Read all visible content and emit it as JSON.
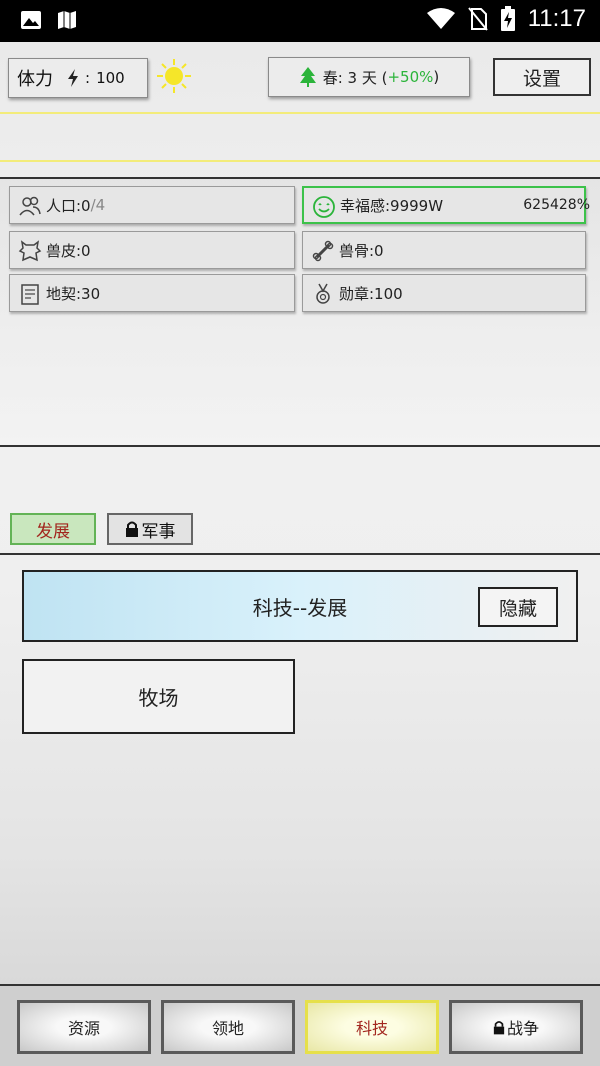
{
  "status_bar": {
    "time": "11:17"
  },
  "top": {
    "stamina_label": "体力",
    "stamina_value": "100",
    "season_label": "春: 3 天 (",
    "season_bonus": "+50%",
    "season_close": ")",
    "settings_label": "设置"
  },
  "resources": {
    "population_label": "人口:0",
    "population_max": "/4",
    "happiness_label": "幸福感:9999W",
    "happiness_pct": "625428%",
    "hide_label": "兽皮:0",
    "bone_label": "兽骨:0",
    "deed_label": "地契:30",
    "medal_label": "勋章:100"
  },
  "tabs": {
    "develop": "发展",
    "military": "军事"
  },
  "tech": {
    "header": "科技--发展",
    "hide_button": "隐藏",
    "ranch": "牧场"
  },
  "nav": {
    "resources": "资源",
    "territory": "领地",
    "tech": "科技",
    "war": "战争"
  },
  "colors": {
    "accent_green": "#2bb43a",
    "active_yellow": "#e6e04a",
    "active_text": "#a2261e"
  }
}
